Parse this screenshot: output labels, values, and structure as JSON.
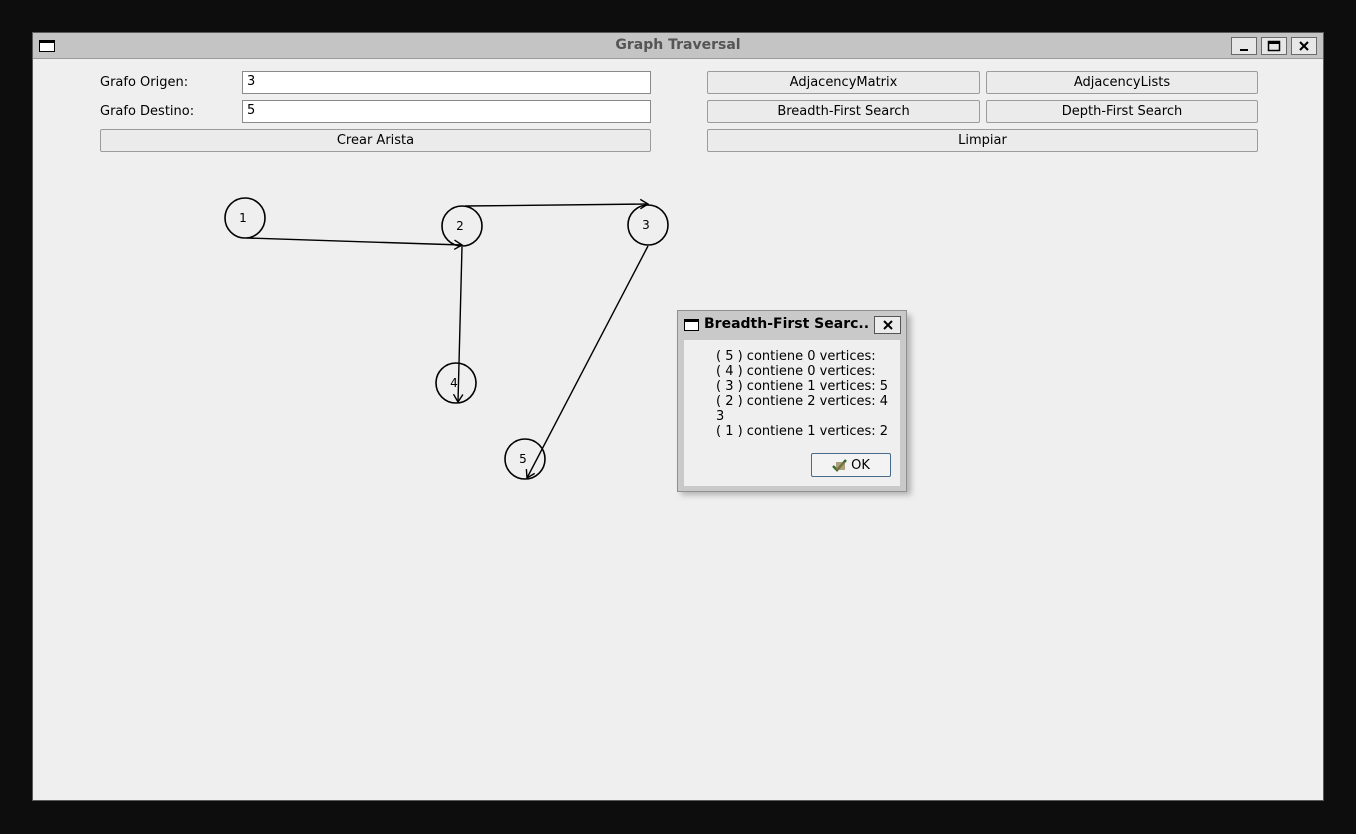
{
  "window": {
    "title": "Graph Traversal"
  },
  "form": {
    "origin_label": "Grafo Origen:",
    "origin_value": "3",
    "dest_label": "Grafo Destino:",
    "dest_value": "5",
    "create_edge_label": "Crear Arista"
  },
  "actions": {
    "adjacency_matrix": "AdjacencyMatrix",
    "adjacency_lists": "AdjacencyLists",
    "bfs": "Breadth-First Search",
    "dfs": "Depth-First Search",
    "clear": "Limpiar"
  },
  "graph": {
    "nodes": [
      {
        "id": 1,
        "label": "1"
      },
      {
        "id": 2,
        "label": "2"
      },
      {
        "id": 3,
        "label": "3"
      },
      {
        "id": 4,
        "label": "4"
      },
      {
        "id": 5,
        "label": "5"
      }
    ],
    "edges": [
      {
        "from": 1,
        "to": 2
      },
      {
        "from": 2,
        "to": 3
      },
      {
        "from": 2,
        "to": 4
      },
      {
        "from": 3,
        "to": 5
      }
    ]
  },
  "dialog": {
    "title": "Breadth-First Searc...",
    "lines": [
      "( 5 ) contiene 0 vertices:",
      "( 4 ) contiene 0 vertices:",
      "( 3 ) contiene 1 vertices: 5",
      "( 2 ) contiene 2 vertices: 4 3",
      "( 1 ) contiene 1 vertices: 2"
    ],
    "ok_label": "OK"
  },
  "colors": {
    "window_bg": "#efefef",
    "titlebar_bg": "#c4c4c4",
    "desktop_bg": "#0d0d0d"
  }
}
